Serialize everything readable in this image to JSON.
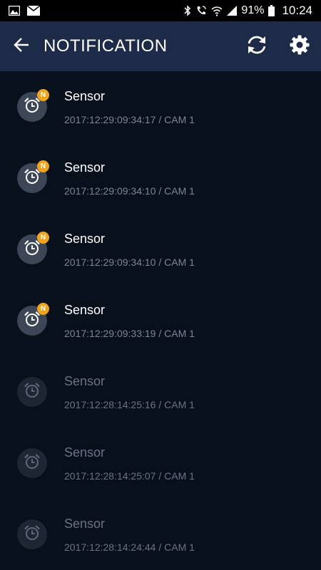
{
  "status_bar": {
    "icons": [
      "image-icon",
      "mail-icon",
      "bluetooth-icon",
      "wifi-call-icon",
      "wifi-icon",
      "signal-icon",
      "battery-icon"
    ],
    "battery": "91%",
    "time": "10:24"
  },
  "app_bar": {
    "title": "NOTIFICATION",
    "back_icon": "back-arrow-icon",
    "refresh_icon": "refresh-icon",
    "settings_icon": "settings-icon",
    "background": "#1d2b49"
  },
  "notifications": [
    {
      "title": "Sensor",
      "subtitle": "2017:12:29:09:34:17 / CAM 1",
      "badge": "N",
      "unread": true
    },
    {
      "title": "Sensor",
      "subtitle": "2017:12:29:09:34:10 / CAM 1",
      "badge": "N",
      "unread": true
    },
    {
      "title": "Sensor",
      "subtitle": "2017:12:29:09:34:10 / CAM 1",
      "badge": "N",
      "unread": true
    },
    {
      "title": "Sensor",
      "subtitle": "2017:12:29:09:33:19 / CAM 1",
      "badge": "N",
      "unread": true
    },
    {
      "title": "Sensor",
      "subtitle": "2017:12:28:14:25:16 / CAM 1",
      "badge": "",
      "unread": false
    },
    {
      "title": "Sensor",
      "subtitle": "2017:12:28:14:25:07 / CAM 1",
      "badge": "",
      "unread": false
    },
    {
      "title": "Sensor",
      "subtitle": "2017:12:28:14:24:44 / CAM 1",
      "badge": "",
      "unread": false
    }
  ],
  "colors": {
    "background": "#08101c",
    "badge": "#f2a31c",
    "unread_avatar": "#3c4657",
    "read_avatar": "#1e2633"
  }
}
